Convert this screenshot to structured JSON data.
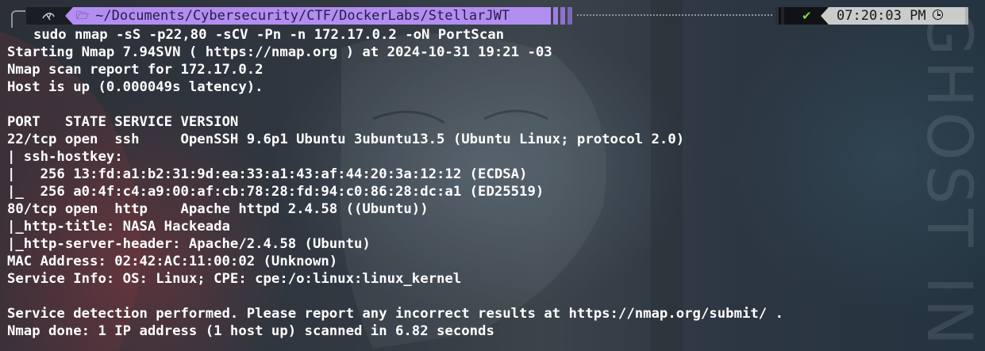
{
  "prompt": {
    "os_icon": "kali-dragon-icon",
    "folder_icon": "folder-icon",
    "path": "~/Documents/Cybersecurity/CTF/DockerLabs/StellarJWT",
    "status_icon": "checkmark-icon",
    "status_symbol": "✔",
    "time": "07:20:03 PM",
    "clock_icon": "clock-icon",
    "colors": {
      "path_bg": "#b28ef0",
      "time_bg": "#c9ccc8",
      "check": "#7fdc3a"
    }
  },
  "command": "sudo nmap -sS -p22,80 -sCV -Pn -n 172.17.0.2 -oN PortScan",
  "output_lines": [
    "Starting Nmap 7.94SVN ( https://nmap.org ) at 2024-10-31 19:21 -03",
    "Nmap scan report for 172.17.0.2",
    "Host is up (0.000049s latency).",
    "",
    "PORT   STATE SERVICE VERSION",
    "22/tcp open  ssh     OpenSSH 9.6p1 Ubuntu 3ubuntu13.5 (Ubuntu Linux; protocol 2.0)",
    "| ssh-hostkey: ",
    "|   256 13:fd:a1:b2:31:9d:ea:33:a1:43:af:44:20:3a:12:12 (ECDSA)",
    "|_  256 a0:4f:c4:a9:00:af:cb:78:28:fd:94:c0:86:28:dc:a1 (ED25519)",
    "80/tcp open  http    Apache httpd 2.4.58 ((Ubuntu))",
    "|_http-title: NASA Hackeada",
    "|_http-server-header: Apache/2.4.58 (Ubuntu)",
    "MAC Address: 02:42:AC:11:00:02 (Unknown)",
    "Service Info: OS: Linux; CPE: cpe:/o:linux:linux_kernel",
    "",
    "Service detection performed. Please report any incorrect results at https://nmap.org/submit/ .",
    "Nmap done: 1 IP address (1 host up) scanned in 6.82 seconds"
  ],
  "wallpaper_text": "GHOST IN THE SHELL"
}
